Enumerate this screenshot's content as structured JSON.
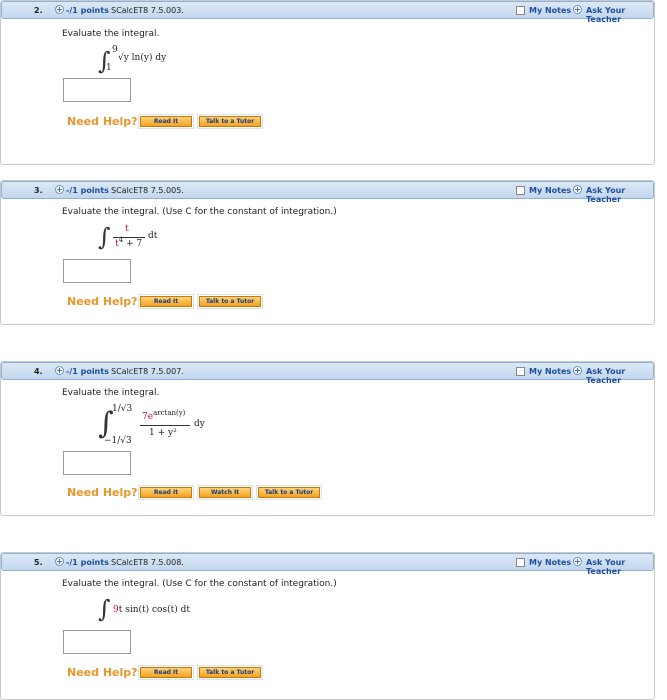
{
  "common": {
    "points": "-/1 points",
    "my_notes": "My Notes",
    "ask_teacher": "Ask Your Teacher",
    "need_help": "Need Help?",
    "read_it": "Read It",
    "watch_it": "Watch It",
    "talk_tutor": "Talk to a Tutor"
  },
  "questions": [
    {
      "number": "2.",
      "code": "SCalcET8 7.5.003.",
      "prompt": "Evaluate the integral.",
      "upper": "9",
      "lower": "1",
      "integrand": "√y ln(y) dy"
    },
    {
      "number": "3.",
      "code": "SCalcET8 7.5.005.",
      "prompt": "Evaluate the integral. (Use C for the constant of integration.)",
      "numerator": "t",
      "denominator_base": "t",
      "denominator_exp": "4",
      "denominator_rest": " + 7",
      "differential": "dt"
    },
    {
      "number": "4.",
      "code": "SCalcET8 7.5.007.",
      "prompt": "Evaluate the integral.",
      "upper": "1/√3",
      "lower": "−1/√3",
      "numerator_coef": "7e",
      "numerator_exp": "arctan(y)",
      "denominator": "1 + y²",
      "differential": "dy"
    },
    {
      "number": "5.",
      "code": "SCalcET8 7.5.008.",
      "prompt": "Evaluate the integral. (Use C for the constant of integration.)",
      "coef": "9",
      "integrand": "t sin(t) cos(t) dt"
    }
  ]
}
